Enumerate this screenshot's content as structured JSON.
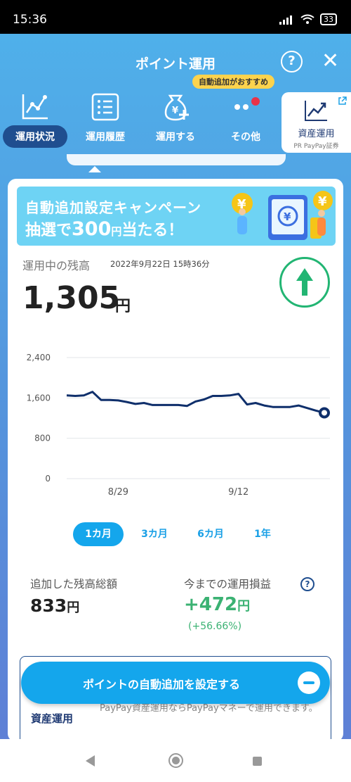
{
  "status_bar": {
    "time": "15:36",
    "battery": "33"
  },
  "header": {
    "title": "ポイント運用",
    "help_label": "?",
    "close_label": "✕"
  },
  "promo_tag": "自動追加がおすすめ",
  "nav": [
    {
      "label": "運用状況",
      "icon": "chart-icon",
      "active": true
    },
    {
      "label": "運用履歴",
      "icon": "list-icon",
      "active": false
    },
    {
      "label": "運用する",
      "icon": "yen-bag-icon",
      "active": false
    },
    {
      "label": "その他",
      "icon": "more-dots-icon",
      "active": false
    }
  ],
  "asset_card": {
    "label": "資産運用",
    "sub": "PR PayPay証券",
    "icon": "chart-up-icon"
  },
  "banner": {
    "line1": "自動追加設定キャンペーン",
    "line2_a": "抽選で",
    "line2_b": "300",
    "line2_c": "円",
    "line2_d": "当たる！"
  },
  "balance": {
    "label": "運用中の残高",
    "date": "2022年9月22日 15時36分",
    "value": "1,305",
    "unit": "円"
  },
  "chart_data": {
    "type": "line",
    "yticks": [
      "2,400",
      "1,600",
      "800",
      "0"
    ],
    "ylim": [
      0,
      2400
    ],
    "xtick_labels": [
      "8/29",
      "9/12"
    ],
    "values": [
      1650,
      1640,
      1650,
      1720,
      1560,
      1560,
      1550,
      1520,
      1480,
      1500,
      1460,
      1460,
      1460,
      1460,
      1440,
      1530,
      1570,
      1640,
      1640,
      1650,
      1680,
      1470,
      1500,
      1450,
      1420,
      1420,
      1420,
      1450,
      1400,
      1350,
      1305
    ],
    "grid": true,
    "color": "#0f2f6b"
  },
  "ranges": [
    "1カ月",
    "3カ月",
    "6カ月",
    "1年"
  ],
  "summary": {
    "added_label": "追加した残高総額",
    "added_value": "833",
    "added_unit": "円",
    "pl_label": "今までの運用損益",
    "pl_value": "+472",
    "pl_unit": "円",
    "pl_pct": "(+56.66%)",
    "info_label": "?"
  },
  "promo": {
    "logo": "資産運用",
    "text": "PayPay資産運用ならPayPayマネーで運用できます。"
  },
  "cta": {
    "label": "ポイントの自動追加を設定する"
  },
  "colors": {
    "accent": "#14a6ec",
    "navy": "#1f4e8f",
    "positive": "#3bb273"
  }
}
